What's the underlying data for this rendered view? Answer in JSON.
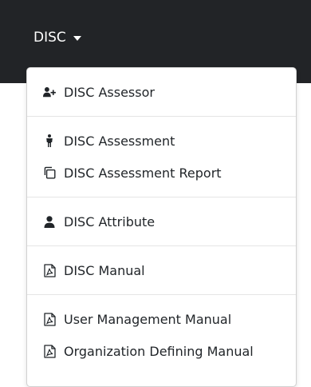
{
  "nav": {
    "toggle_label": "DISC"
  },
  "menu": {
    "items": [
      {
        "label": "DISC Assessor",
        "icon": "user-plus-icon"
      },
      {
        "label": "DISC Assessment",
        "icon": "person-icon"
      },
      {
        "label": "DISC Assessment Report",
        "icon": "copy-icon"
      },
      {
        "label": "DISC Attribute",
        "icon": "user-icon"
      },
      {
        "label": "DISC Manual",
        "icon": "pdf-file-icon"
      },
      {
        "label": "User Management Manual",
        "icon": "pdf-file-icon"
      },
      {
        "label": "Organization Defining Manual",
        "icon": "pdf-file-icon"
      }
    ]
  },
  "colors": {
    "navbar_bg": "#222427",
    "text": "#212529",
    "divider": "#e5e5e5"
  }
}
